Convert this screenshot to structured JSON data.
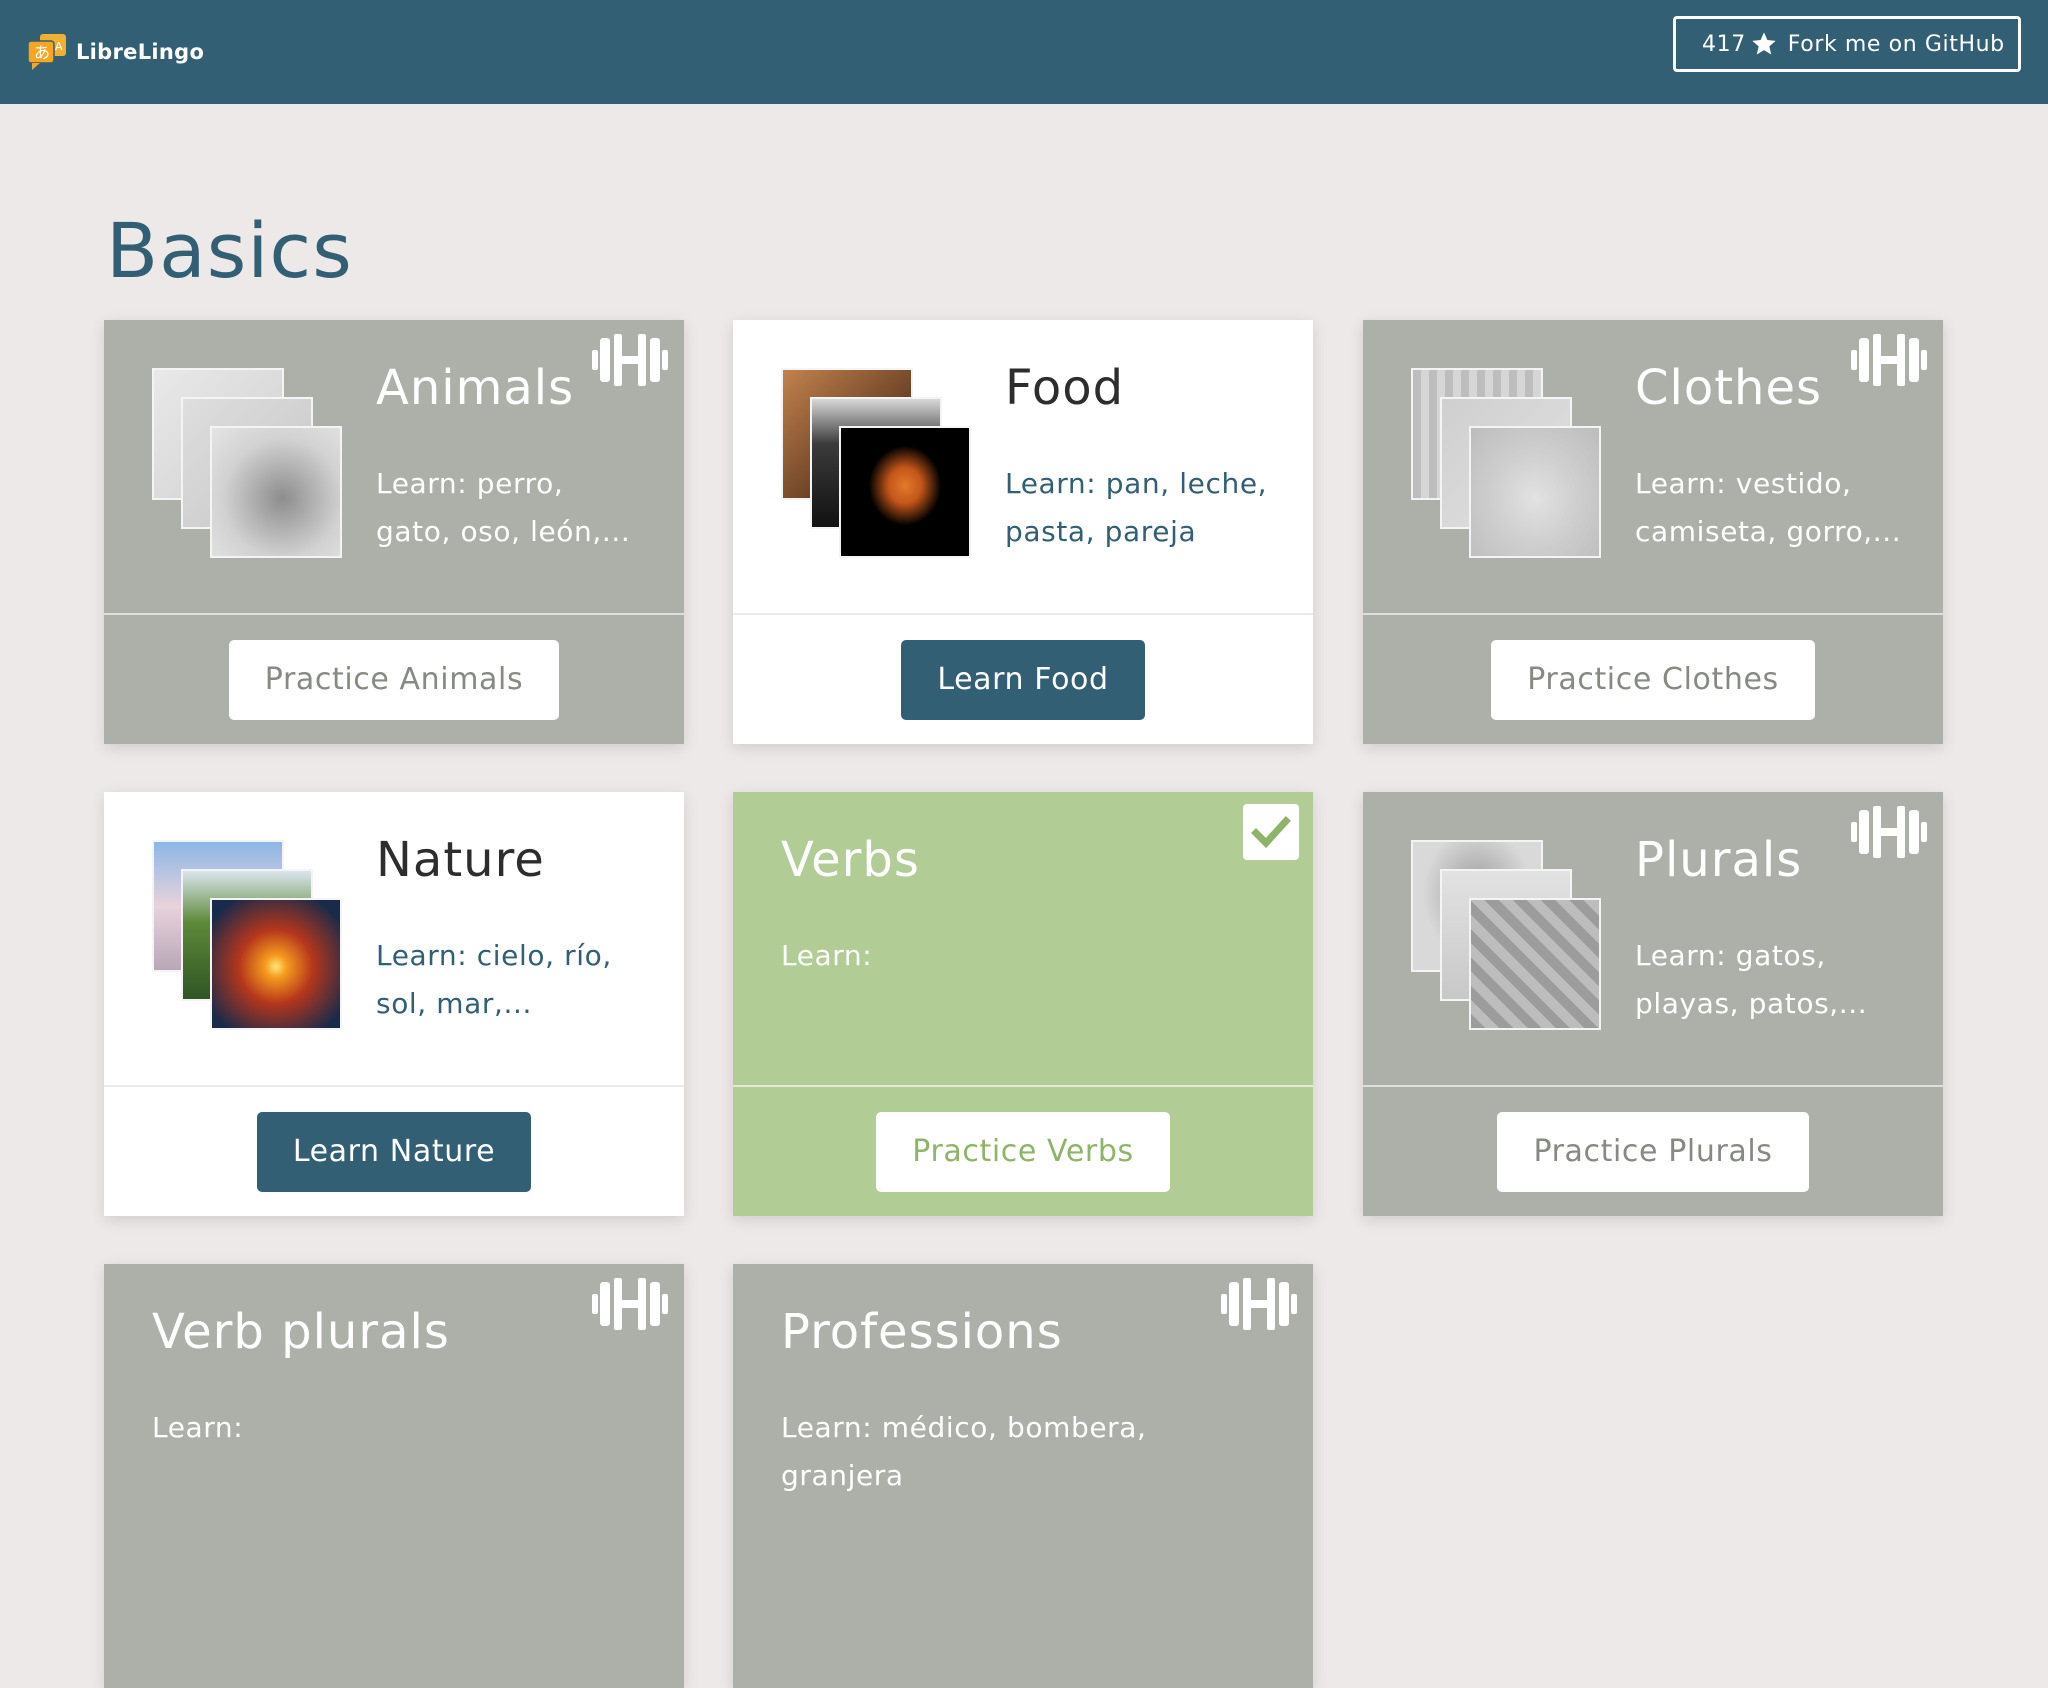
{
  "app": {
    "name": "LibreLingo"
  },
  "github": {
    "stars": "417",
    "label": "Fork me on GitHub"
  },
  "section": {
    "title": "Basics"
  },
  "colors": {
    "header": "#325f74",
    "background": "#ede9e8",
    "completed": "#b2cc96",
    "practice": "#adb0a9",
    "new": "#ffffff"
  },
  "cards": [
    {
      "title": "Animals",
      "learn": "Learn: perro, gato, oso, león,...",
      "button": "Practice Animals",
      "state": "practice",
      "icon": "dumbbell-icon"
    },
    {
      "title": "Food",
      "learn": "Learn: pan, leche, pasta, pareja",
      "button": "Learn Food",
      "state": "new"
    },
    {
      "title": "Clothes",
      "learn": "Learn: vestido, camiseta, gorro,...",
      "button": "Practice Clothes",
      "state": "practice",
      "icon": "dumbbell-icon"
    },
    {
      "title": "Nature",
      "learn": "Learn: cielo, río, sol, mar,...",
      "button": "Learn Nature",
      "state": "new"
    },
    {
      "title": "Verbs",
      "learn": "Learn:",
      "button": "Practice Verbs",
      "state": "completed",
      "icon": "check-icon"
    },
    {
      "title": "Plurals",
      "learn": "Learn: gatos, playas, patos,...",
      "button": "Practice Plurals",
      "state": "practice",
      "icon": "dumbbell-icon"
    },
    {
      "title": "Verb plurals",
      "learn": "Learn:",
      "state": "practice",
      "icon": "dumbbell-icon"
    },
    {
      "title": "Professions",
      "learn": "Learn: médico, bombera, granjera",
      "state": "practice",
      "icon": "dumbbell-icon"
    }
  ]
}
